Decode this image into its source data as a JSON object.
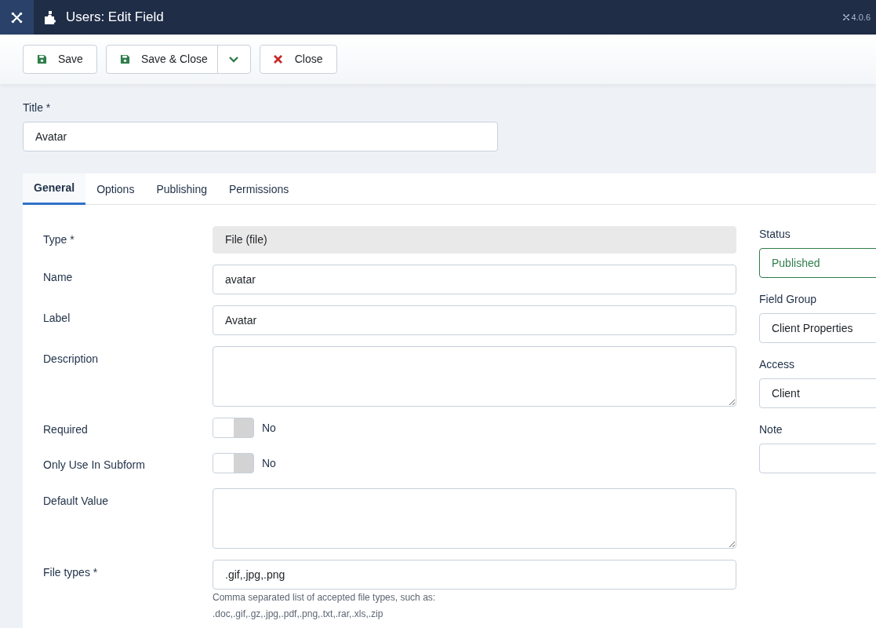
{
  "header": {
    "title": "Users: Edit Field",
    "version": "4.0.6"
  },
  "toolbar": [
    {
      "label": "Save",
      "kind": "save"
    },
    {
      "label": "Save & Close",
      "kind": "save-split"
    },
    {
      "label": "Close",
      "kind": "close"
    }
  ],
  "title_field": {
    "label": "Title *",
    "value": "Avatar"
  },
  "tabs": [
    {
      "label": "General",
      "selected": true
    },
    {
      "label": "Options",
      "selected": false
    },
    {
      "label": "Publishing",
      "selected": false
    },
    {
      "label": "Permissions",
      "selected": false
    }
  ],
  "fields": [
    {
      "label": "Type *",
      "kind": "readonly",
      "value": "File (file)"
    },
    {
      "label": "Name",
      "kind": "text",
      "value": "avatar"
    },
    {
      "label": "Label",
      "kind": "text",
      "value": "Avatar"
    },
    {
      "label": "Description",
      "kind": "textarea"
    },
    {
      "label": "Required",
      "kind": "toggle",
      "on": false,
      "value": "No"
    },
    {
      "label": "Only Use In Subform",
      "kind": "toggle",
      "on": false,
      "value": "No"
    },
    {
      "label": "Default Value",
      "kind": "textarea"
    },
    {
      "label": "File types *",
      "kind": "text",
      "value": ".gif,.jpg,.png",
      "help": [
        "Comma separated list of accepted file types, such as:",
        ".doc,.gif,.gz,.jpg,.pdf,.png,.txt,.rar,.xls,.zip"
      ]
    }
  ],
  "side_fields": [
    {
      "label": "Status",
      "value": "Published",
      "kind": "status"
    },
    {
      "label": "Field Group",
      "value": "Client Properties",
      "kind": "select"
    },
    {
      "label": "Access",
      "value": "Client",
      "kind": "select"
    },
    {
      "label": "Note",
      "kind": "text"
    }
  ]
}
